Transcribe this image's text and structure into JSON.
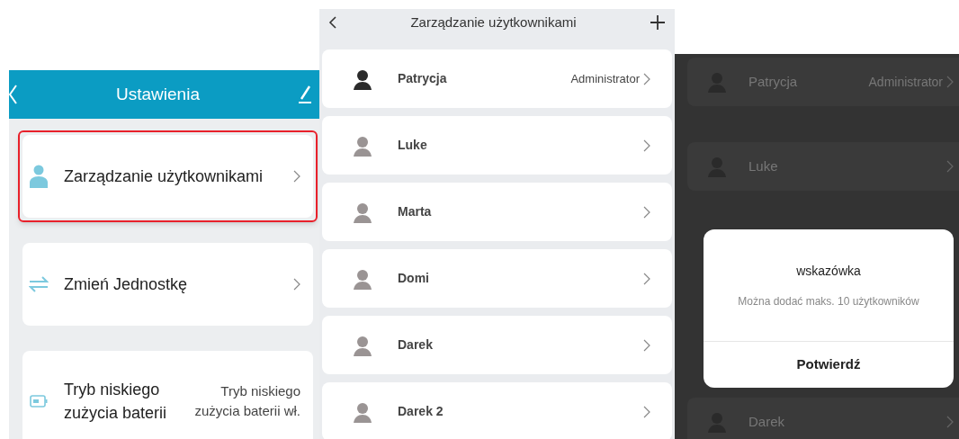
{
  "settings_screen": {
    "title": "Ustawienia",
    "items": [
      {
        "label": "Zarządzanie użytkownikami",
        "highlighted": true
      },
      {
        "label": "Zmień Jednostkę",
        "highlighted": false
      },
      {
        "label": "Tryb niskiego zużycia baterii",
        "value": "Tryb niskiego zużycia baterii wł.",
        "highlighted": false
      }
    ]
  },
  "users_screen": {
    "title": "Zarządzanie użytkownikami",
    "users": [
      {
        "name": "Patrycja",
        "role": "Administrator"
      },
      {
        "name": "Luke"
      },
      {
        "name": "Marta"
      },
      {
        "name": "Domi"
      },
      {
        "name": "Darek"
      },
      {
        "name": "Darek 2"
      }
    ]
  },
  "dialog_screen": {
    "background_users": [
      {
        "name": "Patrycja",
        "role": "Administrator"
      },
      {
        "name": "Luke"
      },
      {
        "name": "Darek"
      }
    ],
    "dialog": {
      "title": "wskazówka",
      "message": "Można dodać maks. 10 użytkowników",
      "button": "Potwierdź"
    }
  }
}
